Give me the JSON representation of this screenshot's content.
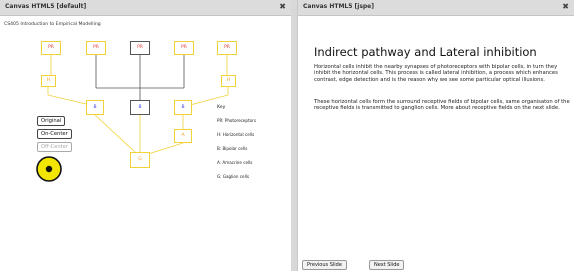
{
  "left_window": {
    "title": "Canvas HTML5 [default]",
    "close_glyph": "✖",
    "subtitle": "CS405 Introduction to Empirical Modelling"
  },
  "right_window": {
    "title": "Canvas HTML5 [jspe]",
    "close_glyph": "✖"
  },
  "diagram": {
    "photoreceptor_label": "PR",
    "horizontal_label": "H",
    "bipolar_label": "B",
    "amacrine_label": "A",
    "ganglion_label": "G",
    "colors": {
      "default_line": "#f2d23a",
      "active_line": "#555555",
      "photoreceptor_text": "#e83a3a",
      "horizontal_text": "#e8a020",
      "bipolar_text": "#3a3ae8",
      "amacrine_text": "#e8a020",
      "ganglion_text": "#e8a020"
    }
  },
  "controls": {
    "original": "Original",
    "on_center": "On-Center",
    "off_center": "Off-Center",
    "eye_icon": "bullseye-icon"
  },
  "key": {
    "title": "Key",
    "items": [
      "PR: Photoreceptors",
      "H: Horizontal cells",
      "B: Bipolar cells",
      "A: Amacrine cells",
      "G: Gaglion cells"
    ]
  },
  "slide": {
    "heading": "Indirect pathway and Lateral inhibition",
    "paragraph1": "Horizontal cells inhibit the nearby synapses of photoreceptors with bipolar cells, in turn they inhibit the horizontal cells. This process is called lateral inhibition, a process which enhances contrast, edge detection and is the reason why we see some particular optical illusions.",
    "paragraph2": "These horizontal cells form the surround receptive fields of bipolar cells, same organisaton of the receptive fields is transmitted to ganglion cells. More about receptive fields on the next slide.",
    "prev_label": "Previous Slide",
    "next_label": "Next Slide"
  }
}
